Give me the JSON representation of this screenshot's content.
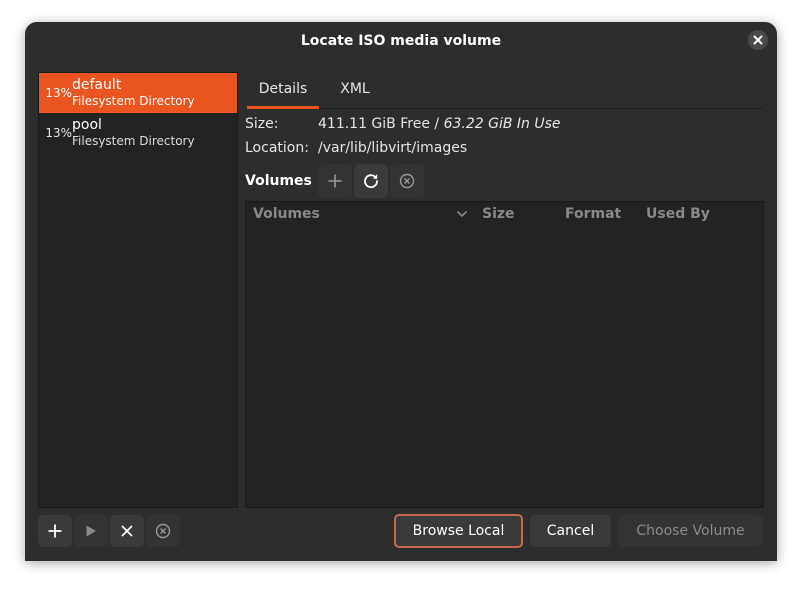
{
  "dialog": {
    "title": "Locate ISO media volume"
  },
  "pools": [
    {
      "percent": "13%",
      "name": "default",
      "type": "Filesystem Directory",
      "selected": true
    },
    {
      "percent": "13%",
      "name": "pool",
      "type": "Filesystem Directory",
      "selected": false
    }
  ],
  "tabs": [
    {
      "label": "Details",
      "active": true
    },
    {
      "label": "XML",
      "active": false
    }
  ],
  "details": {
    "size_label": "Size:",
    "size_free": "411.11 GiB Free",
    "size_sep": " / ",
    "size_used": "63.22 GiB In Use",
    "location_label": "Location:",
    "location_value": "/var/lib/libvirt/images"
  },
  "volumes": {
    "label": "Volumes",
    "columns": [
      "Volumes",
      "Size",
      "Format",
      "Used By"
    ],
    "rows": []
  },
  "footer": {
    "browse_local": "Browse Local",
    "cancel": "Cancel",
    "choose_volume": "Choose Volume"
  },
  "icons": {
    "close": "close-icon",
    "add": "plus-icon",
    "refresh": "refresh-icon",
    "delete": "circle-x-icon",
    "start": "play-icon",
    "stop": "x-icon"
  },
  "colors": {
    "accent": "#e95420",
    "dialog_bg": "#2d2d2d",
    "list_bg": "#232323"
  }
}
